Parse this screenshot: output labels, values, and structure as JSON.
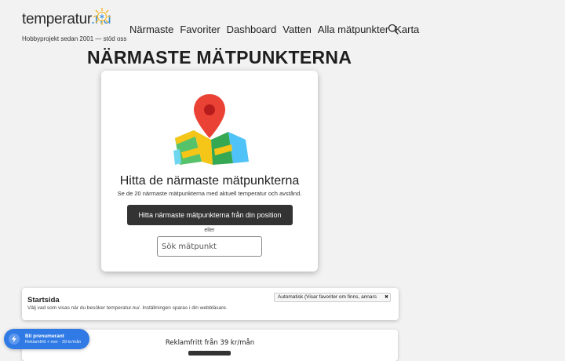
{
  "header": {
    "logo_main": "temperatur",
    "logo_accent": ".nu",
    "tagline": "Hobbyprojekt sedan 2001 — stöd oss",
    "nav": [
      "Närmaste",
      "Favoriter",
      "Dashboard",
      "Vatten",
      "Alla mätpunkter",
      "Karta"
    ]
  },
  "page": {
    "title": "NÄRMASTE MÄTPUNKTERNA"
  },
  "card": {
    "title": "Hitta de närmaste mätpunkterna",
    "subtitle": "Se de 20 närmaste mätpunkterna med aktuell temperatur och avstånd.",
    "button_label": "Hitta närmaste mätpunkterna från din position",
    "or_text": "eller",
    "search_placeholder": "Sök mätpunkt"
  },
  "startsida": {
    "title": "Startsida",
    "description": "Välj vad som visas när du besöker temperatur.nu/. Inställningen sparas i din webbläsare.",
    "selected": "Automatisk (Visar favoriter om finns, annars"
  },
  "promo": {
    "text": "Reklamfritt från 39 kr/mån"
  },
  "subscribe": {
    "title": "Bli prenumerant",
    "subtitle": "Reklamfritt + mer · 39 kr/mån"
  },
  "colors": {
    "brand_blue": "#3d8fd6",
    "pill_blue": "#2f7ae5",
    "button_dark": "#333333"
  }
}
